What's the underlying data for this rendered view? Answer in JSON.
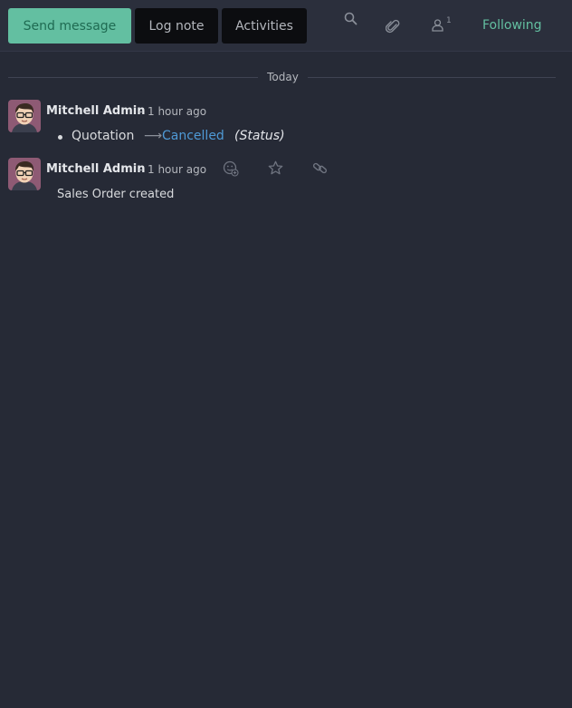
{
  "toolbar": {
    "send_message": "Send message",
    "log_note": "Log note",
    "activities": "Activities",
    "follower_count": "1",
    "following": "Following"
  },
  "date_separator": "Today",
  "messages": [
    {
      "author": "Mitchell Admin",
      "dash": "-",
      "time": "1 hour ago",
      "tracking": {
        "field_value": "Quotation",
        "arrow": "⟶",
        "new_value": "Cancelled",
        "field_label": "(Status)"
      }
    },
    {
      "author": "Mitchell Admin",
      "dash": "-",
      "time": "1 hour ago",
      "body": "Sales Order created",
      "actions": [
        "add-reaction-icon",
        "star-icon",
        "link-icon"
      ]
    }
  ],
  "colors": {
    "background": "#262a36",
    "accent": "#63bfa1",
    "link": "#4f9ad6"
  }
}
